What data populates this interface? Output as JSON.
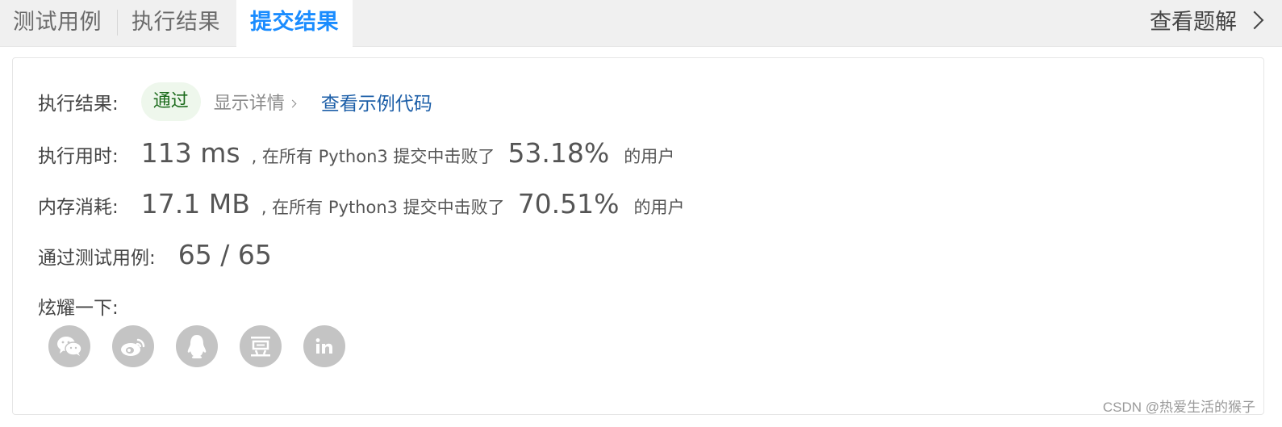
{
  "tabs": {
    "test_cases": "测试用例",
    "run_result": "执行结果",
    "submit_result": "提交结果"
  },
  "view_solution": "查看题解",
  "result": {
    "label": "执行结果:",
    "status": "通过",
    "show_detail": "显示详情",
    "view_sample_code": "查看示例代码"
  },
  "runtime": {
    "label": "执行用时:",
    "value": "113 ms",
    "middle_text": ", 在所有 Python3 提交中击败了",
    "percent": "53.18%",
    "suffix": "的用户"
  },
  "memory": {
    "label": "内存消耗:",
    "value": "17.1 MB",
    "middle_text": ", 在所有 Python3 提交中击败了",
    "percent": "70.51%",
    "suffix": "的用户"
  },
  "testcases": {
    "label": "通过测试用例:",
    "value": "65 / 65"
  },
  "share": {
    "label": "炫耀一下:",
    "icons": [
      "wechat-icon",
      "weibo-icon",
      "qq-icon",
      "douban-icon",
      "linkedin-icon"
    ]
  },
  "watermark": "CSDN @热爱生活的猴子",
  "colors": {
    "accent": "#1a8cff",
    "pass_badge_bg": "#eef7ec",
    "pass_badge_text": "#1c6b1c",
    "link": "#1d5fa8",
    "share_icon_bg": "#c4c4c4"
  }
}
